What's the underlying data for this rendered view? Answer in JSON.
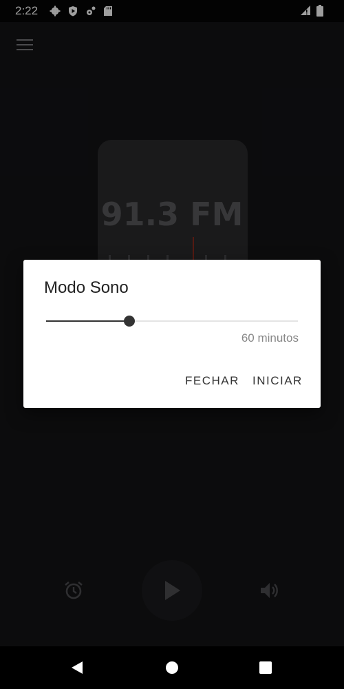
{
  "status_bar": {
    "time": "2:22",
    "icons": [
      "settings-icon",
      "shield-play-icon",
      "settings-sync-icon",
      "sd-card-icon",
      "signal-alert-icon",
      "battery-icon"
    ]
  },
  "app": {
    "menu_icon": "hamburger-menu-icon",
    "frequency": "91.3 FM",
    "needle_color": "#8a2a1e",
    "controls": {
      "alarm_icon": "alarm-icon",
      "play_icon": "play-icon",
      "volume_icon": "volume-icon"
    }
  },
  "dialog": {
    "title": "Modo Sono",
    "slider": {
      "fraction": 0.33,
      "value_label": "60 minutos"
    },
    "buttons": {
      "close": "FECHAR",
      "start": "INICIAR"
    }
  },
  "nav_bar": {
    "icons": [
      "back-icon",
      "home-icon",
      "recent-apps-icon"
    ]
  }
}
